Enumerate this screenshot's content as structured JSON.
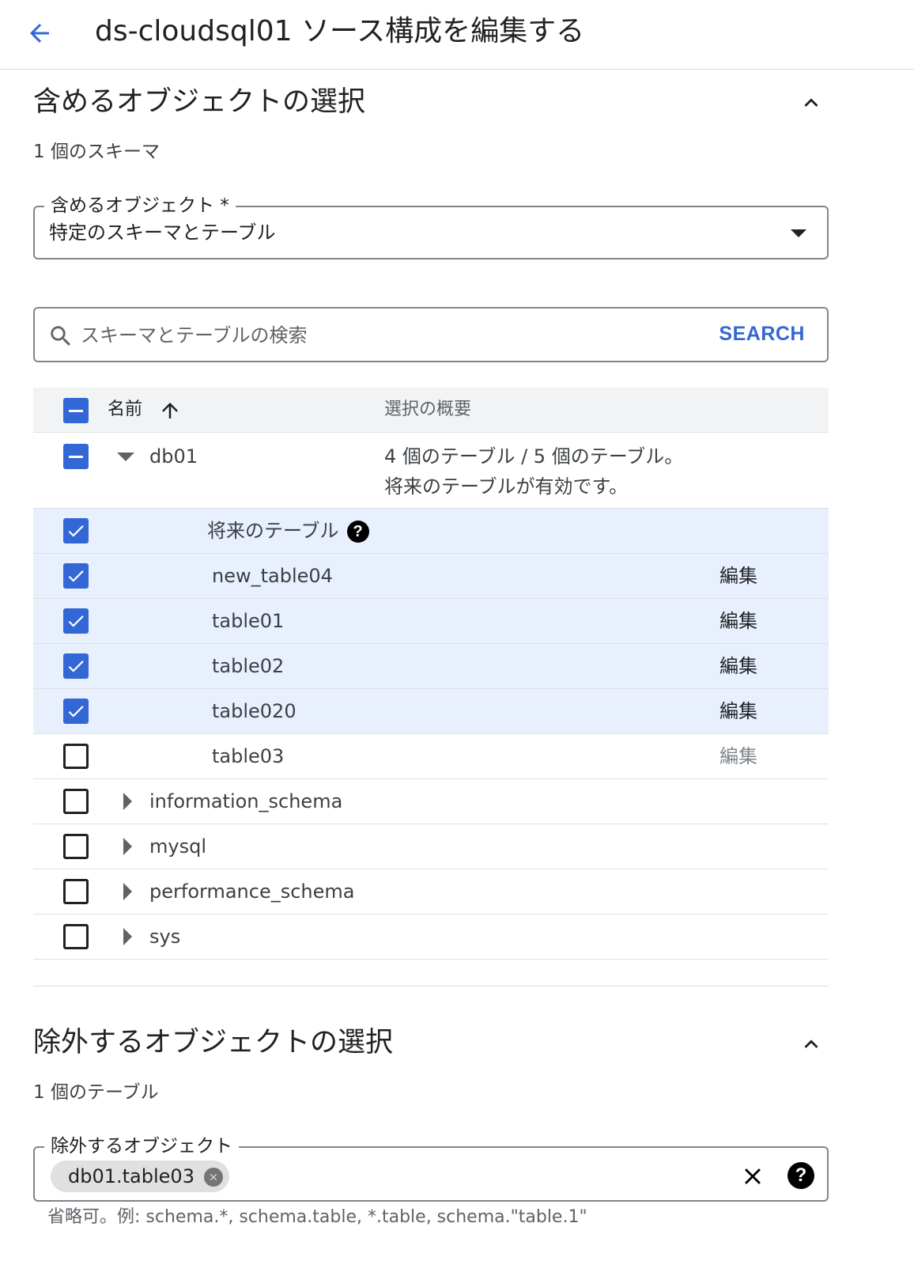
{
  "header": {
    "title": "ds-cloudsql01 ソース構成を編集する"
  },
  "include_section": {
    "title": "含めるオブジェクトの選択",
    "count": "1 個のスキーマ",
    "select_label": "含めるオブジェクト *",
    "select_value": "特定のスキーマとテーブル",
    "search_placeholder": "スキーマとテーブルの検索",
    "search_button": "SEARCH",
    "table": {
      "header": {
        "name": "名前",
        "summary": "選択の概要"
      },
      "db": {
        "name": "db01",
        "summary_line1": "4 個のテーブル / 5 個のテーブル。",
        "summary_line2": "将来のテーブルが有効です。"
      },
      "future_tables": "将来のテーブル",
      "tables": [
        {
          "name": "new_table04",
          "checked": true,
          "edit": "編集"
        },
        {
          "name": "table01",
          "checked": true,
          "edit": "編集"
        },
        {
          "name": "table02",
          "checked": true,
          "edit": "編集"
        },
        {
          "name": "table020",
          "checked": true,
          "edit": "編集"
        },
        {
          "name": "table03",
          "checked": false,
          "edit": "編集"
        }
      ],
      "other_schemas": [
        {
          "name": "information_schema"
        },
        {
          "name": "mysql"
        },
        {
          "name": "performance_schema"
        },
        {
          "name": "sys"
        }
      ]
    }
  },
  "exclude_section": {
    "title": "除外するオブジェクトの選択",
    "count": "1 個のテーブル",
    "field_label": "除外するオブジェクト",
    "chip": "db01.table03",
    "hint": "省略可。例: schema.*, schema.table, *.table, schema.\"table.1\""
  },
  "colors": {
    "accent": "#3367d6",
    "selected_row": "#e8f0fe",
    "header_row": "#f1f3f4"
  }
}
